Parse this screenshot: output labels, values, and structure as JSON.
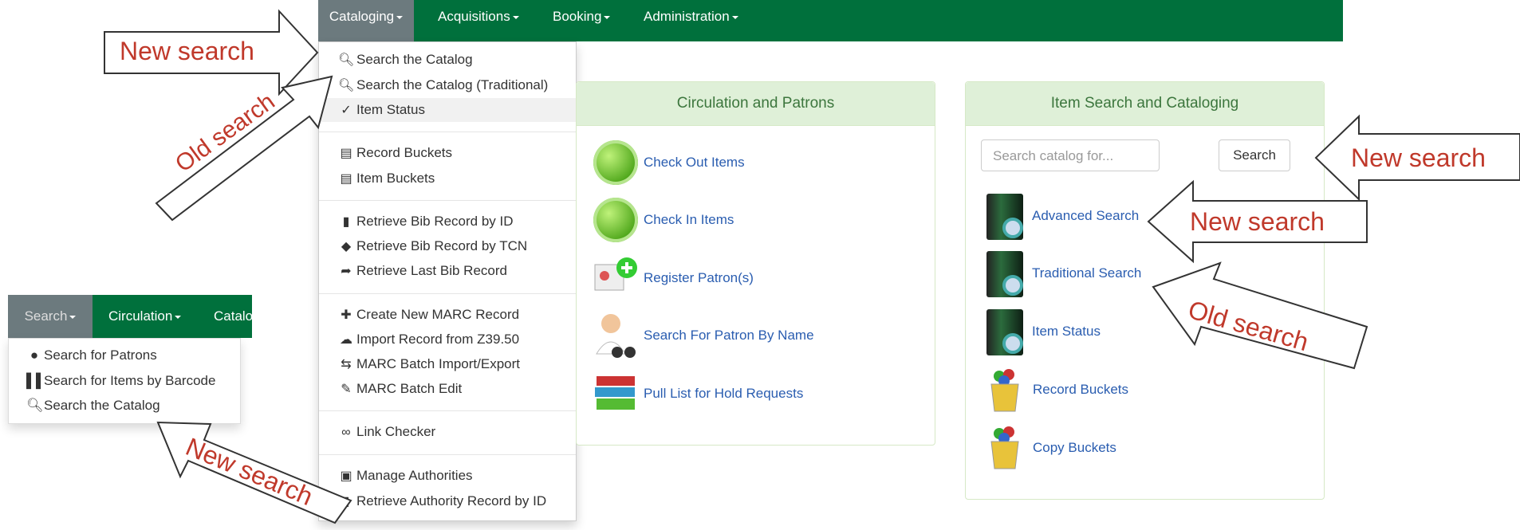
{
  "main_nav": {
    "items": [
      {
        "label": "Cataloging"
      },
      {
        "label": "Acquisitions"
      },
      {
        "label": "Booking"
      },
      {
        "label": "Administration"
      }
    ]
  },
  "cataloging_menu": {
    "items": [
      {
        "label": "Search the Catalog",
        "icon": "search-icon"
      },
      {
        "label": "Search the Catalog (Traditional)",
        "icon": "search-icon"
      },
      {
        "label": "Item Status",
        "icon": "check-icon"
      },
      {
        "label": "Record Buckets",
        "icon": "list-icon"
      },
      {
        "label": "Item Buckets",
        "icon": "list-icon"
      },
      {
        "label": "Retrieve Bib Record by ID",
        "icon": "file-icon"
      },
      {
        "label": "Retrieve Bib Record by TCN",
        "icon": "tag-icon"
      },
      {
        "label": "Retrieve Last Bib Record",
        "icon": "share-icon"
      },
      {
        "label": "Create New MARC Record",
        "icon": "plus-icon"
      },
      {
        "label": "Import Record from Z39.50",
        "icon": "cloud-download-icon"
      },
      {
        "label": "MARC Batch Import/Export",
        "icon": "transfer-icon"
      },
      {
        "label": "MARC Batch Edit",
        "icon": "edit-icon"
      },
      {
        "label": "Link Checker",
        "icon": "link-icon"
      },
      {
        "label": "Manage Authorities",
        "icon": "lock-icon"
      },
      {
        "label": "Retrieve Authority Record by ID",
        "icon": "file-icon"
      }
    ]
  },
  "circ_panel": {
    "title": "Circulation and Patrons",
    "links": [
      {
        "label": "Check Out Items"
      },
      {
        "label": "Check In Items"
      },
      {
        "label": "Register Patron(s)"
      },
      {
        "label": "Search For Patron By Name"
      },
      {
        "label": "Pull List for Hold Requests"
      }
    ]
  },
  "item_panel": {
    "title": "Item Search and Cataloging",
    "search_placeholder": "Search catalog for...",
    "search_button": "Search",
    "links": [
      {
        "label": "Advanced Search"
      },
      {
        "label": "Traditional Search"
      },
      {
        "label": "Item Status"
      },
      {
        "label": "Record Buckets"
      },
      {
        "label": "Copy Buckets"
      }
    ]
  },
  "small_nav": {
    "items": [
      {
        "label": "Search"
      },
      {
        "label": "Circulation"
      },
      {
        "label": "Catalo"
      }
    ]
  },
  "search_menu": {
    "items": [
      {
        "label": "Search for Patrons",
        "icon": "user-icon"
      },
      {
        "label": "Search for Items by Barcode",
        "icon": "barcode-icon"
      },
      {
        "label": "Search the Catalog",
        "icon": "search-icon"
      }
    ]
  },
  "annotations": {
    "new_search_top_left": "New search",
    "old_search_left": "Old search",
    "new_search_right_button": "New search",
    "new_search_advanced": "New search",
    "old_search_traditional": "Old search",
    "new_search_bottom": "New search"
  },
  "colors": {
    "navbar": "#00703c",
    "active_nav": "#6c7a7e",
    "panel_header": "#dff0d8",
    "annotation": "#c0392b",
    "link": "#2a5db0"
  }
}
